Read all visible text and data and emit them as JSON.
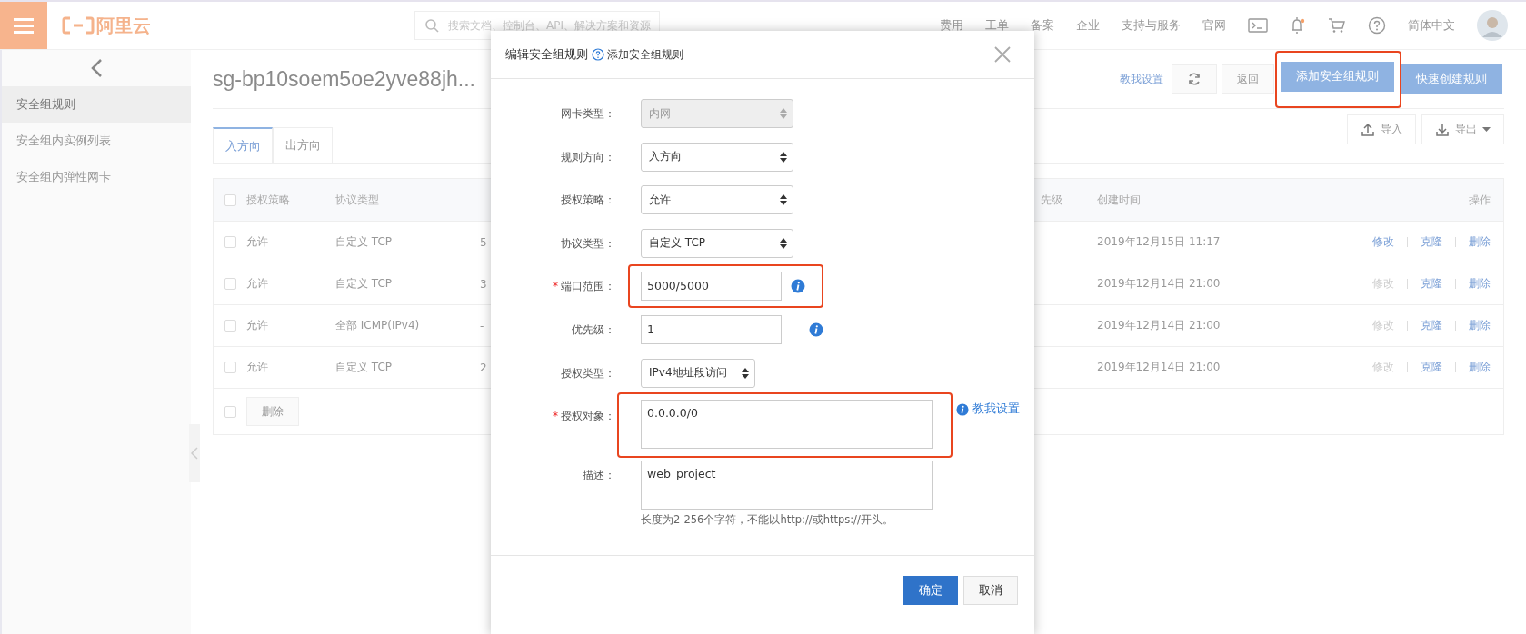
{
  "topbar": {
    "logo": "阿里云",
    "search_placeholder": "搜索文档、控制台、API、解决方案和资源",
    "nav": [
      "费用",
      "工单",
      "备案",
      "企业",
      "支持与服务",
      "官网"
    ],
    "language": "简体中文"
  },
  "sidebar": {
    "items": [
      {
        "label": "安全组规则",
        "selected": true
      },
      {
        "label": "安全组内实例列表",
        "selected": false
      },
      {
        "label": "安全组内弹性网卡",
        "selected": false
      }
    ]
  },
  "page": {
    "title": "sg-bp10soem5oe2yve88jh...",
    "help_link": "教我设置",
    "buttons": [
      {
        "kind": "refresh"
      },
      {
        "kind": "default",
        "label": "返回"
      },
      {
        "kind": "primary",
        "label": "添加安全组规则",
        "highlighted": true
      },
      {
        "kind": "primary",
        "label": "快速创建规则"
      }
    ]
  },
  "tabs": [
    {
      "label": "入方向",
      "selected": true
    },
    {
      "label": "出方向",
      "selected": false
    }
  ],
  "io_buttons": [
    {
      "kind": "upload",
      "label": "导入"
    },
    {
      "kind": "download",
      "label": "导出"
    }
  ],
  "table": {
    "header_checked": false,
    "columns": [
      "授权策略",
      "协议类型",
      "先级",
      "创建时间",
      "操作"
    ],
    "rows": [
      {
        "checked": false,
        "policy": "允许",
        "protocol": "自定义 TCP",
        "column_3": "5",
        "created": "2019年12月15日 11:17",
        "actions": [
          {
            "label": "修改",
            "disabled": false
          },
          {
            "label": "克隆",
            "disabled": false
          },
          {
            "label": "删除",
            "disabled": false
          }
        ]
      },
      {
        "checked": false,
        "policy": "允许",
        "protocol": "自定义 TCP",
        "column_3": "3",
        "created": "2019年12月14日 21:00",
        "actions": [
          {
            "label": "修改",
            "disabled": true
          },
          {
            "label": "克隆",
            "disabled": false
          },
          {
            "label": "删除",
            "disabled": false
          }
        ]
      },
      {
        "checked": false,
        "policy": "允许",
        "protocol": "全部 ICMP(IPv4)",
        "column_3": "-",
        "created": "2019年12月14日 21:00",
        "actions": [
          {
            "label": "修改",
            "disabled": true
          },
          {
            "label": "克隆",
            "disabled": false
          },
          {
            "label": "删除",
            "disabled": false
          }
        ]
      },
      {
        "checked": false,
        "policy": "允许",
        "protocol": "自定义 TCP",
        "column_3": "2",
        "created": "2019年12月14日 21:00",
        "actions": [
          {
            "label": "修改",
            "disabled": true
          },
          {
            "label": "克隆",
            "disabled": false
          },
          {
            "label": "删除",
            "disabled": false
          }
        ]
      }
    ],
    "footer_checked": false,
    "footer_button": "删除"
  },
  "dialog": {
    "title": "编辑安全组规则",
    "subtitle": "添加安全组规则",
    "fields": [
      {
        "label": "网卡类型：",
        "kind": "select",
        "value": "内网",
        "disabled": true
      },
      {
        "label": "规则方向：",
        "kind": "select",
        "value": "入方向",
        "disabled": false
      },
      {
        "label": "授权策略：",
        "kind": "select",
        "value": "允许",
        "disabled": false
      },
      {
        "label": "协议类型：",
        "kind": "select",
        "value": "自定义 TCP",
        "disabled": false
      },
      {
        "label": "端口范围：",
        "required_mark": "*",
        "kind": "input",
        "value": "5000/5000",
        "info": true,
        "highlighted": true
      },
      {
        "label": "优先级：",
        "kind": "input",
        "value": "1",
        "info": true
      },
      {
        "label": "授权类型：",
        "kind": "short-select",
        "value": "IPv4地址段访问",
        "disabled": false
      },
      {
        "label": "授权对象：",
        "required_mark": "*",
        "kind": "textarea",
        "value": "0.0.0.0/0",
        "link": "教我设置",
        "highlighted": true
      },
      {
        "label": "描述：",
        "kind": "textarea",
        "value": "web_project",
        "hint": "长度为2-256个字符，不能以http://或https://开头。"
      }
    ],
    "buttons": [
      {
        "kind": "primary",
        "label": "确定"
      },
      {
        "kind": "default",
        "label": "取消"
      }
    ]
  }
}
